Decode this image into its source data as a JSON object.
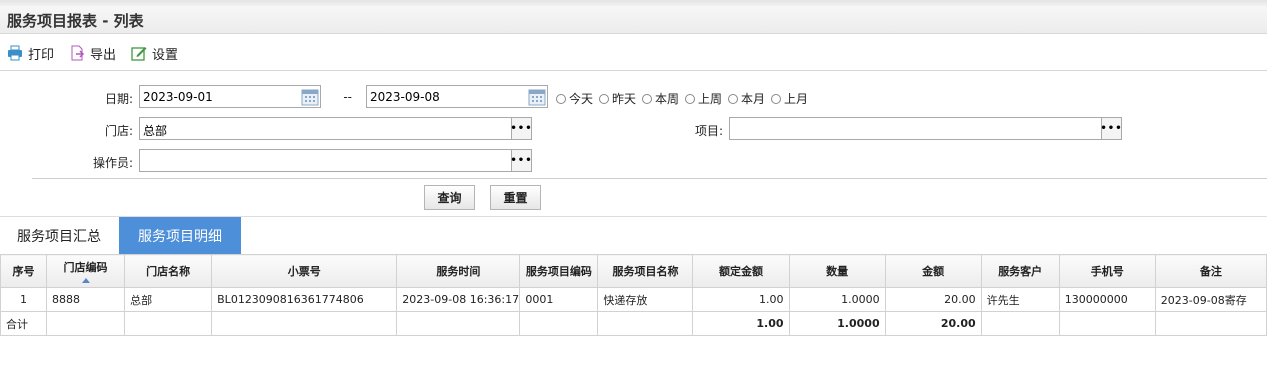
{
  "page": {
    "title": "服务项目报表 - 列表"
  },
  "toolbar": {
    "print_label": "打印",
    "export_label": "导出",
    "settings_label": "设置"
  },
  "filters": {
    "date_label": "日期:",
    "date_from": "2023-09-01",
    "date_sep": "--",
    "date_to": "2023-09-08",
    "quick_ranges": [
      "今天",
      "昨天",
      "本周",
      "上周",
      "本月",
      "上月"
    ],
    "store_label": "门店:",
    "store_value": "总部",
    "item_label": "项目:",
    "item_value": "",
    "operator_label": "操作员:",
    "operator_value": "",
    "more_label": "•••"
  },
  "actions": {
    "query_label": "查询",
    "reset_label": "重置"
  },
  "tabs": [
    {
      "label": "服务项目汇总",
      "active": false
    },
    {
      "label": "服务项目明细",
      "active": true
    }
  ],
  "table": {
    "headers": [
      "序号",
      "门店编码",
      "门店名称",
      "小票号",
      "服务时间",
      "服务项目编码",
      "服务项目名称",
      "额定金额",
      "数量",
      "金额",
      "服务客户",
      "手机号",
      "备注"
    ],
    "rows": [
      [
        "1",
        "8888",
        "总部",
        "BL0123090816361774806",
        "2023-09-08 16:36:17",
        "0001",
        "快递存放",
        "1.00",
        "1.0000",
        "20.00",
        "许先生",
        "130000000",
        "2023-09-08寄存"
      ]
    ],
    "total": [
      "合计",
      "",
      "",
      "",
      "",
      "",
      "",
      "1.00",
      "1.0000",
      "20.00",
      "",
      "",
      ""
    ]
  },
  "colors": {
    "accent": "#4d8fd8",
    "print_icon": "#3a8fc8",
    "export_icon": "#b05ab8",
    "settings_icon": "#3e9a3e"
  }
}
